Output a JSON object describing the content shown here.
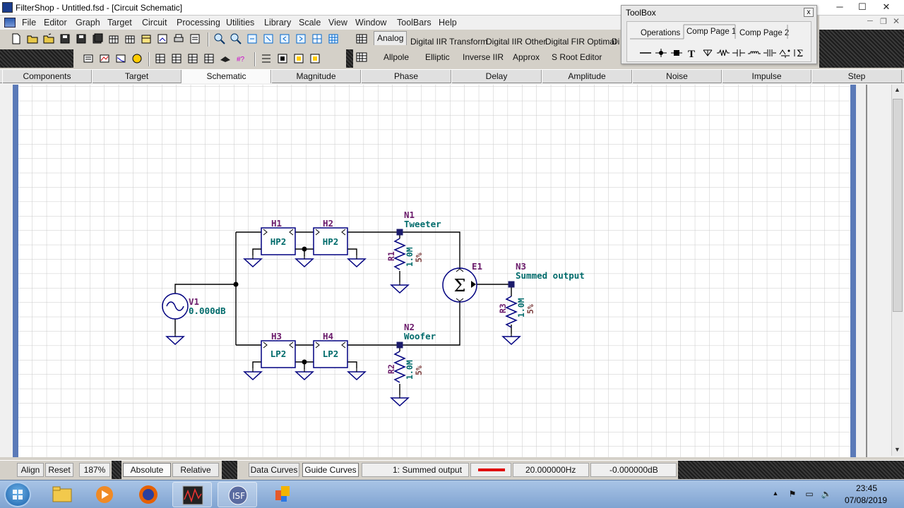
{
  "window": {
    "title": "FilterShop - Untitled.fsd - [Circuit Schematic]",
    "controls": {
      "minimize": "─",
      "maximize": "☐",
      "close": "✕"
    }
  },
  "menubar": {
    "items": [
      "File",
      "Editor",
      "Graph",
      "Target",
      "Circuit",
      "Processing",
      "Utilities",
      "Library",
      "Scale",
      "View",
      "Window",
      "ToolBars",
      "Help"
    ]
  },
  "toolbar_tabs": {
    "row1": [
      "Analog",
      "Digital IIR Transform",
      "Digital IIR Other",
      "Digital FIR Optimal",
      "Di"
    ],
    "row2": [
      "Allpole",
      "Elliptic",
      "Inverse IIR",
      "Approx",
      "S Root Editor"
    ],
    "active": "Analog"
  },
  "toolbox": {
    "title": "ToolBox",
    "close": "x",
    "tabs": [
      "Operations",
      "Comp Page 1",
      "Comp Page 2"
    ],
    "active_tab": "Comp Page 1",
    "tools": [
      "wire-icon",
      "junction-icon",
      "node-icon",
      "text-icon",
      "ground-icon",
      "resistor-icon",
      "capacitor-icon",
      "inductor-icon",
      "transformer-icon",
      "source-icon",
      "summer-icon"
    ]
  },
  "view_tabs": {
    "items": [
      "Components",
      "Target",
      "Schematic",
      "Magnitude",
      "Phase",
      "Delay",
      "Amplitude",
      "Noise",
      "Impulse",
      "Step"
    ],
    "active": "Schematic"
  },
  "schematic": {
    "source": {
      "name": "V1",
      "value": "0.000dB"
    },
    "blocks": [
      {
        "name": "H1",
        "type": "HP2"
      },
      {
        "name": "H2",
        "type": "HP2"
      },
      {
        "name": "H3",
        "type": "LP2"
      },
      {
        "name": "H4",
        "type": "LP2"
      }
    ],
    "nodes": [
      {
        "name": "N1",
        "label": "Tweeter"
      },
      {
        "name": "N2",
        "label": "Woofer"
      },
      {
        "name": "N3",
        "label": "Summed output"
      }
    ],
    "resistors": [
      {
        "name": "R1",
        "value": "1.0M",
        "tolerance": "5%"
      },
      {
        "name": "R2",
        "value": "1.0M",
        "tolerance": "5%"
      },
      {
        "name": "R3",
        "value": "1.0M",
        "tolerance": "5%"
      }
    ],
    "summer": {
      "name": "E1",
      "symbol": "Σ"
    },
    "colors": {
      "grid": "#c9c9c9",
      "wire": "#000000",
      "component": "#000080",
      "label_name": "#6b1b6b",
      "label_value": "#006b6b",
      "tolerance": "#7a3a3a",
      "rail": "#5b7ab8"
    }
  },
  "statusbar": {
    "align": "Align",
    "reset": "Reset",
    "zoom": "187%",
    "absolute": "Absolute",
    "relative": "Relative",
    "data_curves": "Data Curves",
    "guide_curves": "Guide Curves",
    "curve_name": "1: Summed output",
    "curve_color": "#e00000",
    "frequency": "20.000000Hz",
    "level": "-0.000000dB"
  },
  "taskbar": {
    "apps": [
      "file-explorer-icon",
      "media-player-icon",
      "firefox-icon",
      "oscilloscope-app-icon",
      "filtershop-app-icon",
      "office-app-icon"
    ],
    "time": "23:45",
    "date": "07/08/2019"
  }
}
